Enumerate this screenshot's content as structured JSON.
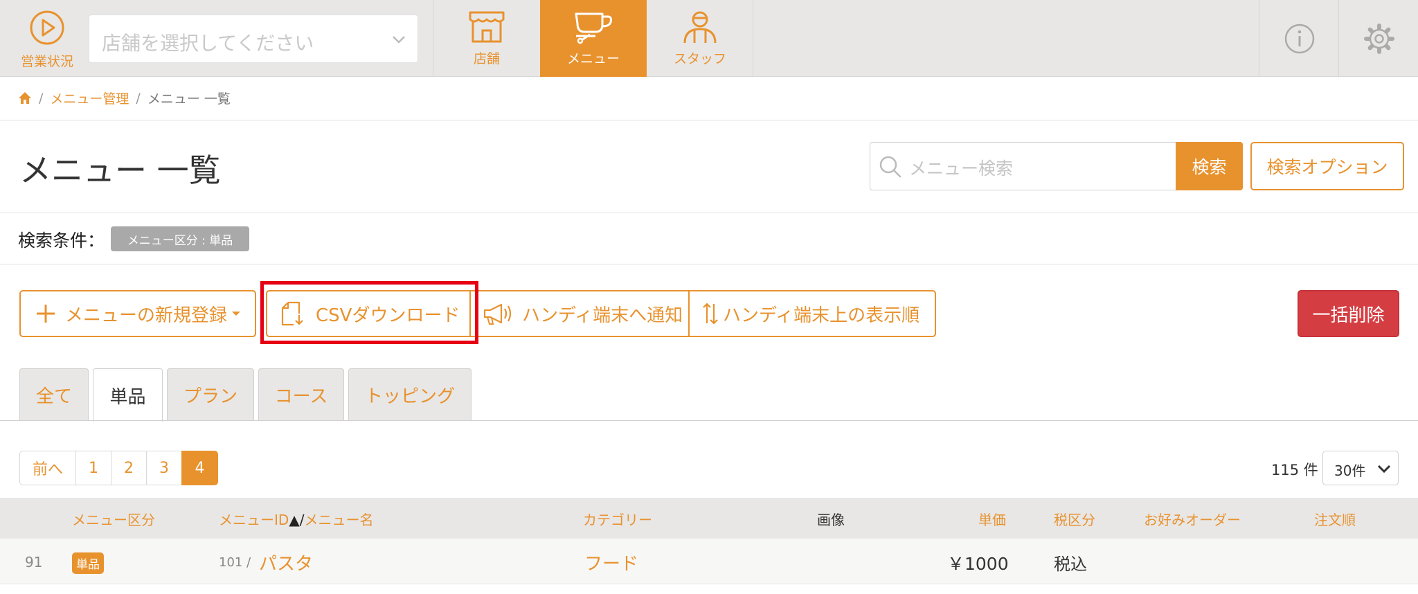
{
  "nav": {
    "status_label": "営業状況",
    "store_placeholder": "店舗を選択してください",
    "tabs": [
      {
        "label": "店舗",
        "icon": "store-icon"
      },
      {
        "label": "メニュー",
        "icon": "cup-icon",
        "active": true
      },
      {
        "label": "スタッフ",
        "icon": "staff-icon"
      }
    ],
    "info_icon": "info-icon",
    "settings_icon": "gear-icon"
  },
  "breadcrumb": {
    "home_icon": "home-icon",
    "items": [
      "メニュー管理",
      "メニュー 一覧"
    ]
  },
  "page": {
    "title": "メニュー 一覧",
    "search_placeholder": "メニュー検索",
    "search_button": "検索",
    "search_options_button": "検索オプション"
  },
  "filter": {
    "label": "検索条件：",
    "tag": "メニュー区分 : 単品"
  },
  "toolbar": {
    "new_menu": "メニューの新規登録",
    "csv_download": "CSVダウンロード",
    "notify_handy": "ハンディ端末へ通知",
    "handy_order": "ハンディ端末上の表示順",
    "bulk_delete": "一括削除"
  },
  "tabs": [
    "全て",
    "単品",
    "プラン",
    "コース",
    "トッピング"
  ],
  "active_tab": "単品",
  "pagination": {
    "prev": "前へ",
    "pages": [
      "1",
      "2",
      "3",
      "4"
    ],
    "current": "4",
    "total": "115 件",
    "per_page": "30件"
  },
  "table": {
    "columns": {
      "type": "メニュー区分",
      "id_name_id": "メニューID",
      "sort_arrow": "▲",
      "slash": "/",
      "id_name_name": "メニュー名",
      "category": "カテゴリー",
      "image": "画像",
      "price": "単価",
      "tax": "税区分",
      "preference": "お好みオーダー",
      "order": "注文順"
    },
    "rows": [
      {
        "no": "91",
        "type": "単品",
        "id": "101 /",
        "name": "パスタ",
        "category": "フード",
        "price": "￥1000",
        "tax": "税込"
      }
    ]
  },
  "colors": {
    "accent": "#e8922e",
    "danger": "#d43e43",
    "highlight": "#e60012"
  }
}
